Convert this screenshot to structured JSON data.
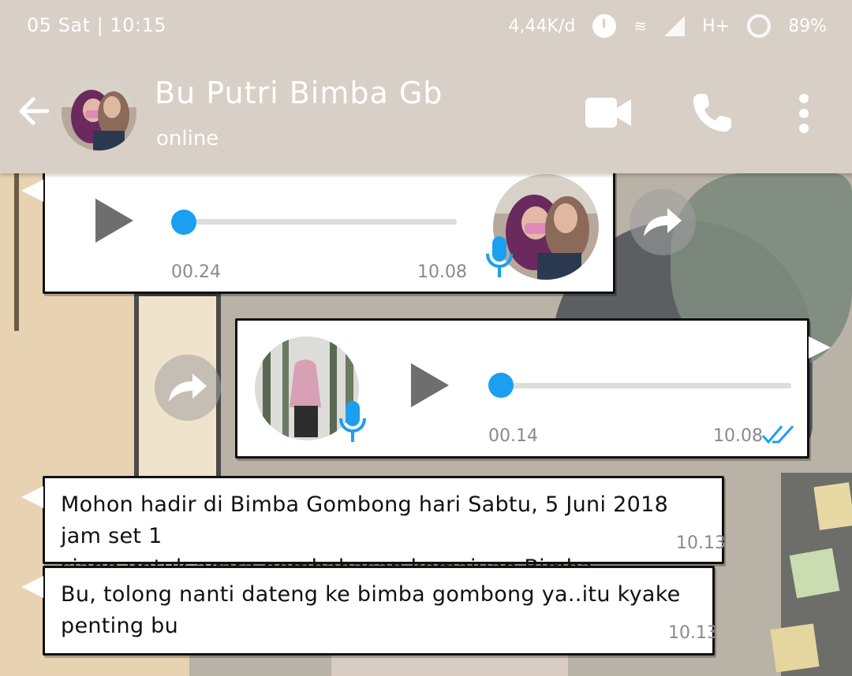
{
  "statusbar": {
    "datetime": "05 Sat | 10:15",
    "net_speed": "4,44K/d",
    "network_type": "H+",
    "battery": "89%"
  },
  "header": {
    "contact_name": "Bu Putri Bimba Gb",
    "status": "online",
    "icons": [
      "back-arrow-icon",
      "video-call-icon",
      "phone-call-icon",
      "more-options-icon"
    ]
  },
  "messages": [
    {
      "type": "voice",
      "direction": "incoming",
      "duration": "00.24",
      "time": "10.08",
      "progress": 0
    },
    {
      "type": "voice",
      "direction": "outgoing",
      "duration": "00.14",
      "time": "10.08",
      "progress": 0,
      "read": true
    },
    {
      "type": "text",
      "direction": "incoming",
      "lines": [
        "Mohon hadir di Bimba Gombong hari Sabtu,  5 Juni 2018 jam set 1",
        "siang untuk acara pembahasan kemajuan Bimba."
      ],
      "time": "10.13"
    },
    {
      "type": "text",
      "direction": "incoming",
      "lines": [
        "Bu, tolong nanti dateng ke bimba gombong ya..itu kyake penting bu"
      ],
      "time": "10.13"
    }
  ],
  "colors": {
    "header_bg": "#d8cfc6",
    "accent_blue": "#1b9ff0",
    "bubble_bg": "#ffffff"
  }
}
